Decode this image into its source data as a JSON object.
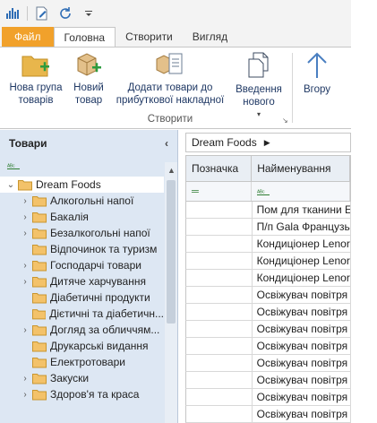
{
  "tabs": {
    "file": "Файл",
    "home": "Головна",
    "create": "Створити",
    "view": "Вигляд"
  },
  "ribbon": {
    "buttons": {
      "new_group": "Нова група\nтоварів",
      "new_product": "Новий\nтовар",
      "add_to_invoice": "Додати товари до\nприбуткової накладної",
      "new_entry": "Введення\nнового"
    },
    "group_create": "Створити",
    "up": "Вгору"
  },
  "left_panel": {
    "title": "Товари",
    "tree": [
      {
        "label": "Dream Foods",
        "root": true
      },
      {
        "label": "Алкогольні напої",
        "arrow": true
      },
      {
        "label": "Бакалія",
        "arrow": true
      },
      {
        "label": "Безалкогольні напої",
        "arrow": true
      },
      {
        "label": "Відпочинок та туризм",
        "arrow": false
      },
      {
        "label": "Господарчі товари",
        "arrow": true
      },
      {
        "label": "Дитяче харчування",
        "arrow": true
      },
      {
        "label": "Діабетичні продукти",
        "arrow": false
      },
      {
        "label": "Дієтичні та діабетичн...",
        "arrow": false
      },
      {
        "label": "Догляд за обличчям...",
        "arrow": true
      },
      {
        "label": "Друкарські видання",
        "arrow": false
      },
      {
        "label": "Електротовари",
        "arrow": false
      },
      {
        "label": "Закуски",
        "arrow": true
      },
      {
        "label": "Здоров'я та краса",
        "arrow": true
      }
    ]
  },
  "breadcrumb": "Dream Foods",
  "grid": {
    "columns": [
      "Позначка",
      "Найменування"
    ],
    "rows": [
      "Пом для тканини Е",
      "П/п Gala Французь",
      "Кондиціонер Lenor",
      "Кондиціонер Lenor",
      "Кондиціонер Lenor",
      "Освіжувач повітря",
      "Освіжувач повітря",
      "Освіжувач повітря",
      "Освіжувач повітря",
      "Освіжувач повітря",
      "Освіжувач повітря",
      "Освіжувач повітря",
      "Освіжувач повітря"
    ]
  }
}
